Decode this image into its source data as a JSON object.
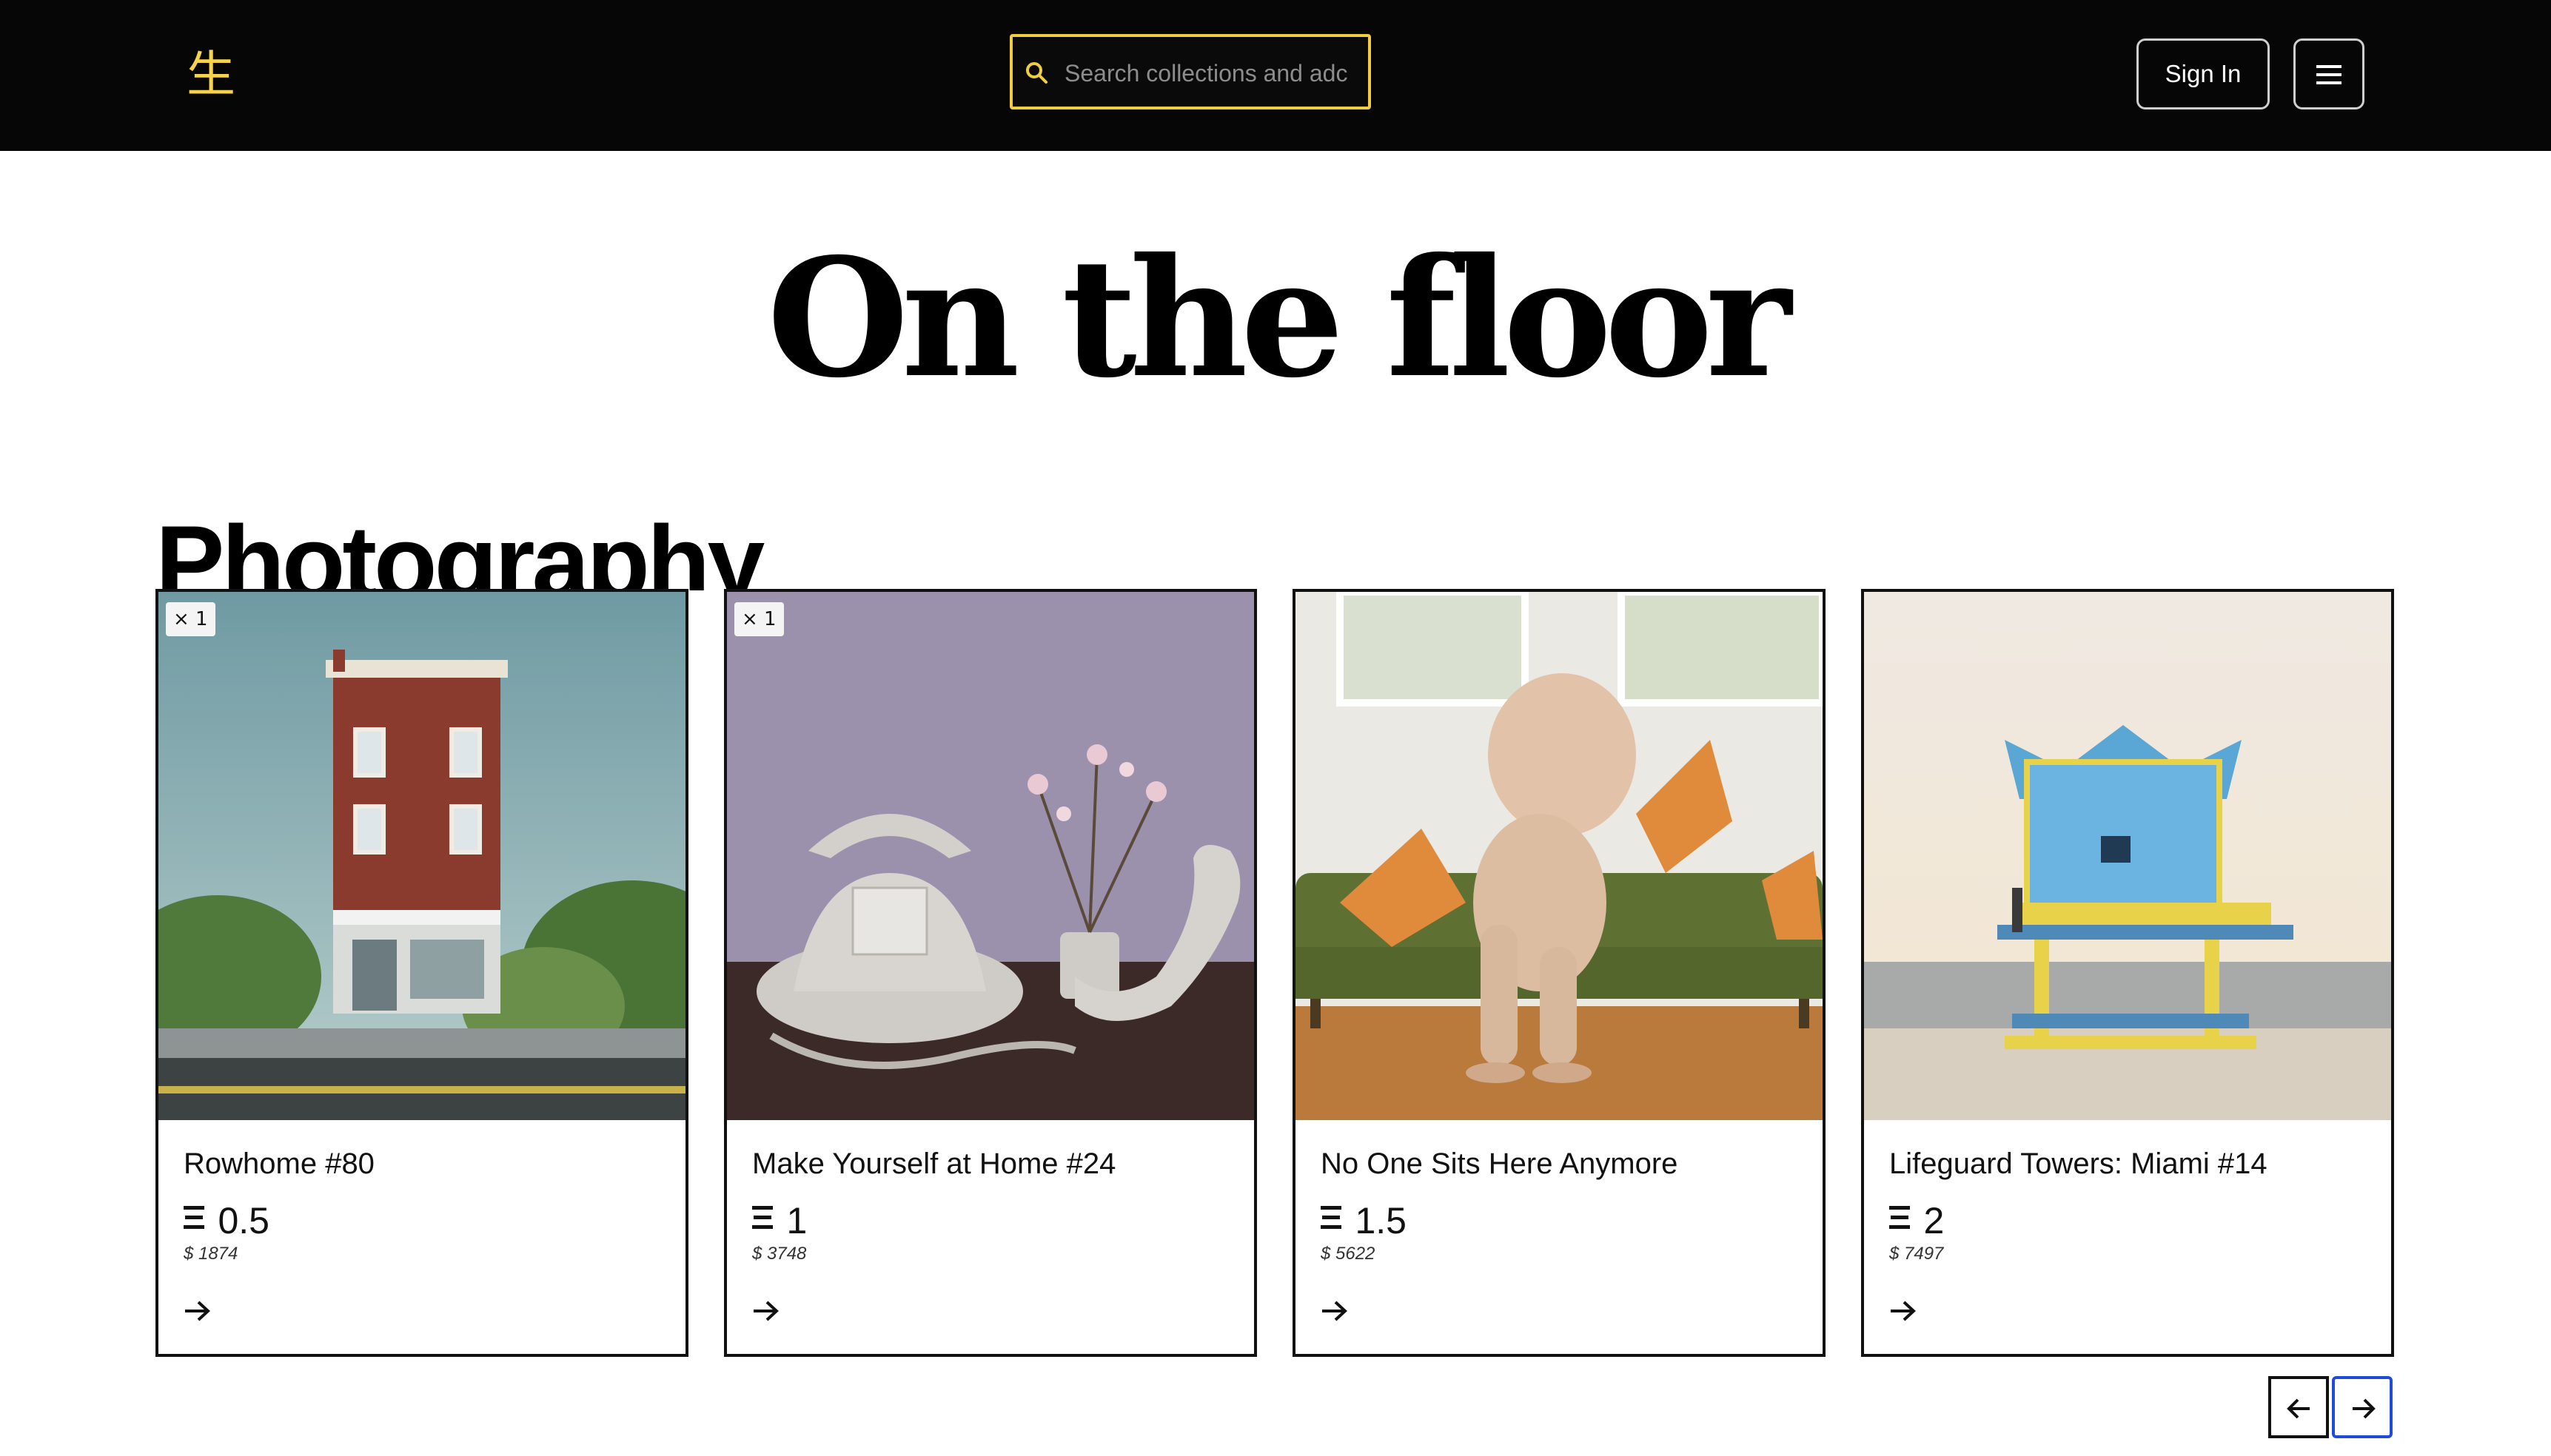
{
  "header": {
    "logo_text": "生",
    "search_placeholder": "Search collections and adc",
    "sign_in_label": "Sign In",
    "accent_color": "#f0cd40"
  },
  "page_title": "On the floor",
  "section_title": "Photography",
  "cards": [
    {
      "badge": "× 1",
      "title": "Rowhome #80",
      "price": "0.5",
      "usd": "$ 1874"
    },
    {
      "badge": "× 1",
      "title": "Make Yourself at Home #24",
      "price": "1",
      "usd": "$ 3748"
    },
    {
      "badge": "",
      "title": "No One Sits Here Anymore",
      "price": "1.5",
      "usd": "$ 5622"
    },
    {
      "badge": "",
      "title": "Lifeguard Towers: Miami #14",
      "price": "2",
      "usd": "$ 7497"
    }
  ],
  "icons": {
    "search": "search-icon",
    "menu": "hamburger-menu-icon",
    "currency": "ethereum-icon",
    "card_arrow": "arrow-right-icon",
    "prev": "arrow-left-icon",
    "next": "arrow-right-icon"
  }
}
